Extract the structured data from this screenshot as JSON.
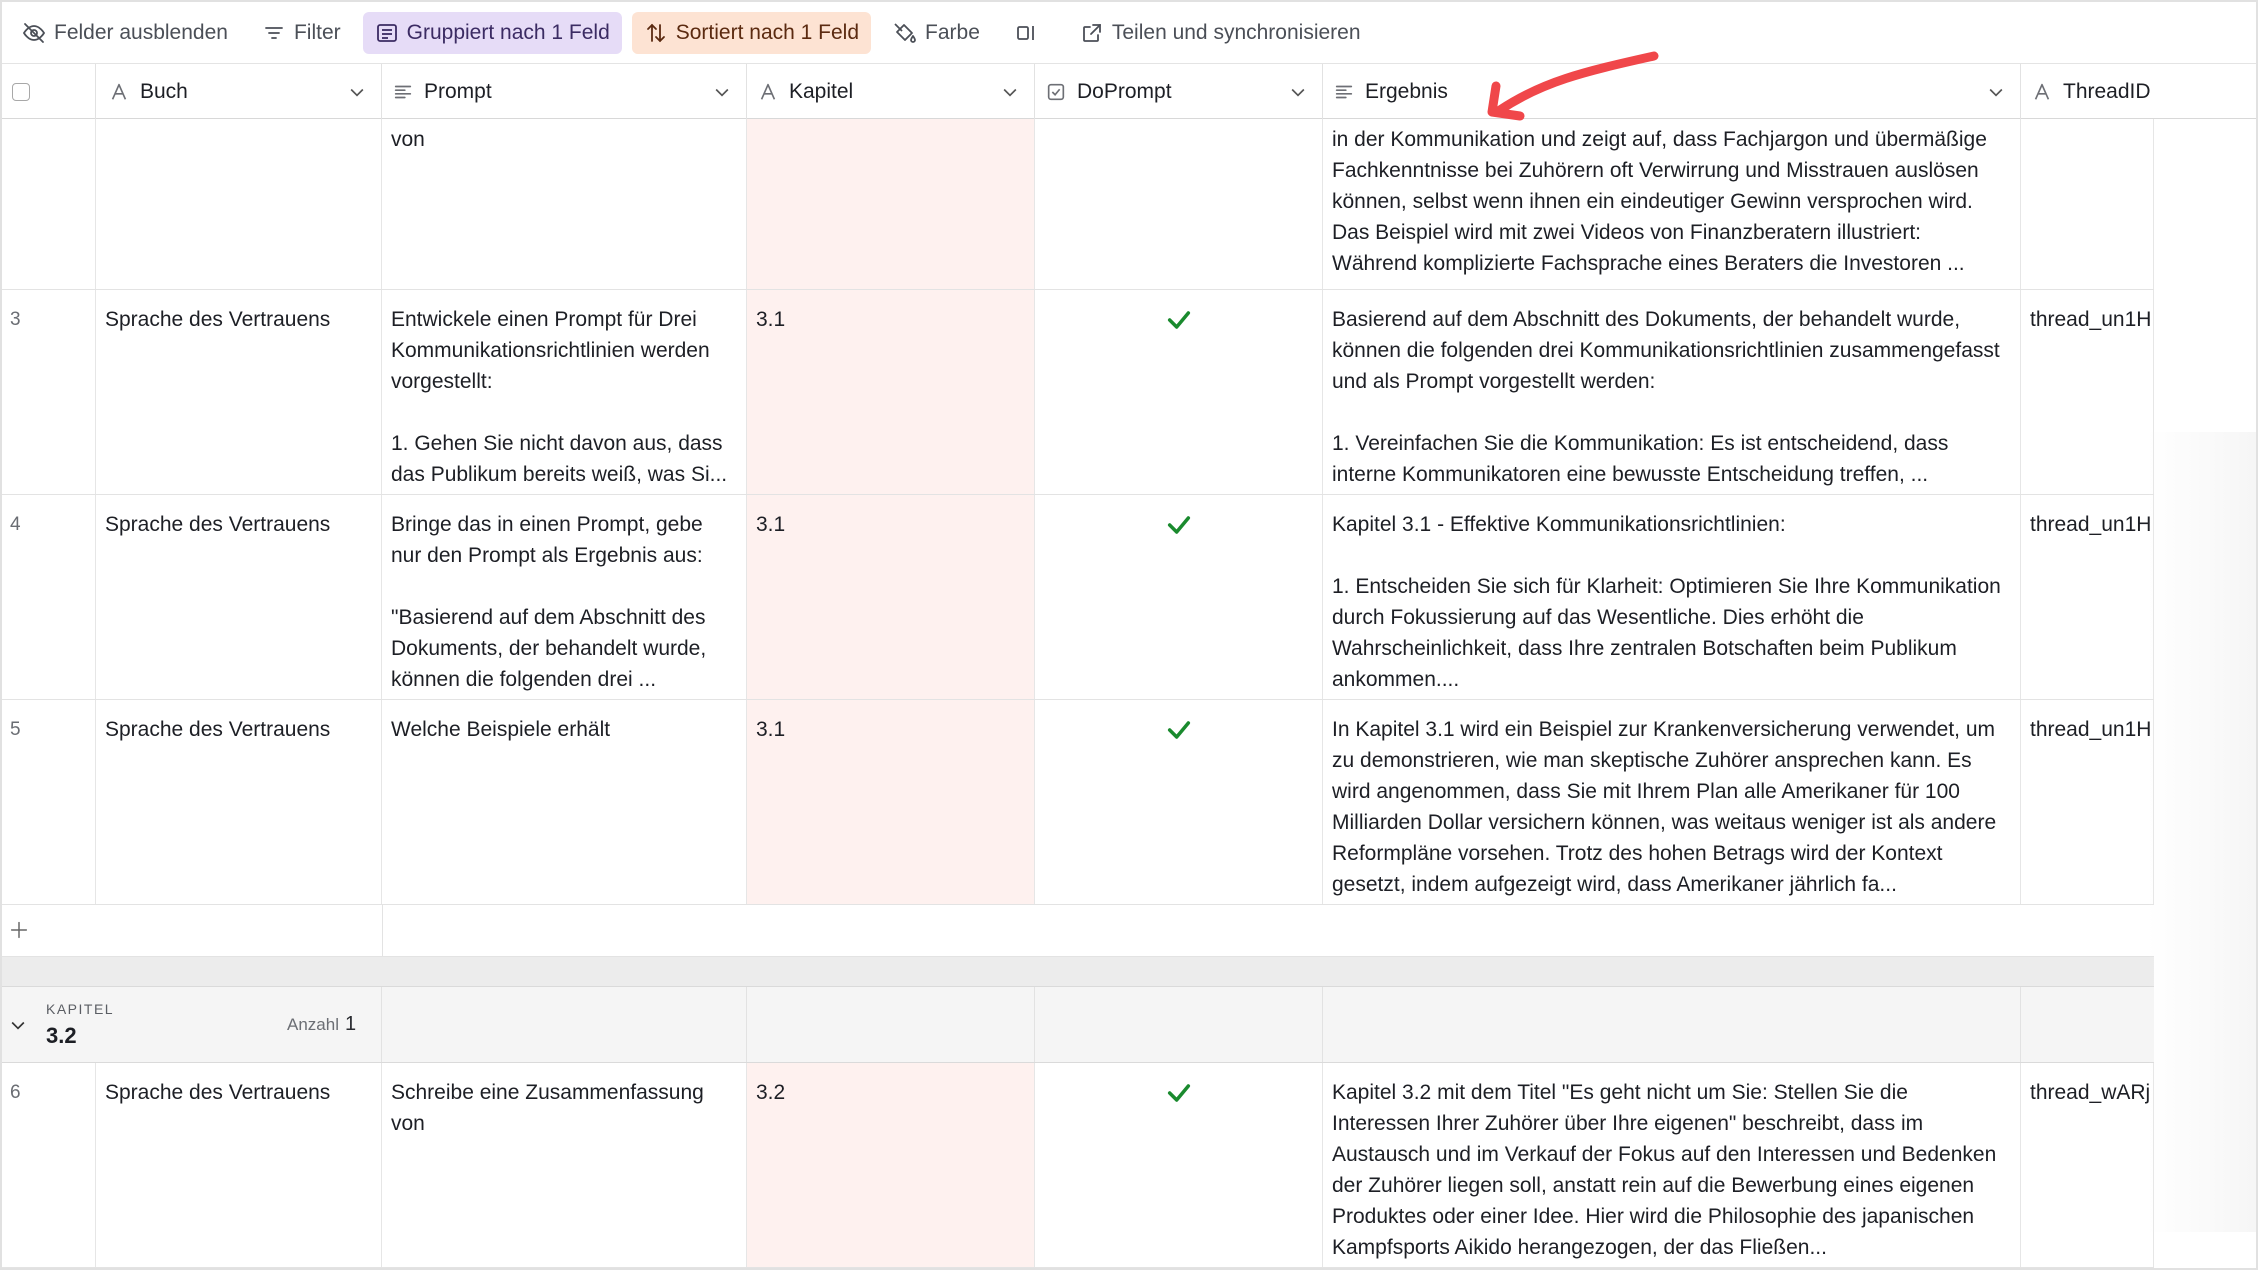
{
  "toolbar": {
    "hide_fields": "Felder ausblenden",
    "filter": "Filter",
    "grouped": "Gruppiert nach 1 Feld",
    "sorted": "Sortiert nach 1 Feld",
    "color": "Farbe",
    "share": "Teilen und synchronisieren"
  },
  "columns": {
    "buch": "Buch",
    "prompt": "Prompt",
    "kapitel": "Kapitel",
    "doprompt": "DoPrompt",
    "ergebnis": "Ergebnis",
    "threadid": "ThreadID"
  },
  "rows": [
    {
      "num": "",
      "buch": "",
      "prompt": "von",
      "kapitel": "",
      "doprompt": false,
      "ergebnis": "in der Kommunikation und zeigt auf, dass Fachjargon und übermäßige Fachkenntnisse bei Zuhörern oft Verwirrung und Misstrauen auslösen können, selbst wenn ihnen ein eindeutiger Gewinn versprochen wird. Das Beispiel wird mit zwei Videos von Finanzberatern illustriert: Während komplizierte Fachsprache eines Beraters die Investoren ...",
      "threadid": ""
    },
    {
      "num": "3",
      "buch": "Sprache des Vertrauens",
      "prompt": "Entwickele einen Prompt für Drei Kommunikationsrichtlinien werden vorgestellt:\n\n1. Gehen Sie nicht davon aus, dass das Publikum bereits weiß, was Si...",
      "kapitel": "3.1",
      "doprompt": true,
      "ergebnis": "Basierend auf dem Abschnitt des Dokuments, der behandelt wurde, können die folgenden drei Kommunikationsrichtlinien zusammengefasst und als Prompt vorgestellt werden:\n\n1. Vereinfachen Sie die Kommunikation: Es ist entscheidend, dass interne Kommunikatoren eine bewusste Entscheidung treffen, ...",
      "threadid": "thread_un1H"
    },
    {
      "num": "4",
      "buch": "Sprache des Vertrauens",
      "prompt": "Bringe das in einen Prompt, gebe nur den Prompt als Ergebnis aus:\n\n\"Basierend auf dem Abschnitt des Dokuments, der behandelt wurde, können die folgenden drei ...",
      "kapitel": "3.1",
      "doprompt": true,
      "ergebnis": "Kapitel 3.1 - Effektive Kommunikationsrichtlinien:\n\n1. Entscheiden Sie sich für Klarheit: Optimieren Sie Ihre Kommunikation durch Fokussierung auf das Wesentliche. Dies erhöht die Wahrscheinlichkeit, dass Ihre zentralen Botschaften beim Publikum ankommen....",
      "threadid": "thread_un1H"
    },
    {
      "num": "5",
      "buch": "Sprache des Vertrauens",
      "prompt": "Welche Beispiele erhält",
      "kapitel": "3.1",
      "doprompt": true,
      "ergebnis": "In Kapitel 3.1 wird ein Beispiel zur Krankenversicherung verwendet, um zu demonstrieren, wie man skeptische Zuhörer ansprechen kann. Es wird angenommen, dass Sie mit Ihrem Plan alle Amerikaner für 100 Milliarden Dollar versichern können, was weitaus weniger ist als andere Reformpläne vorsehen. Trotz des hohen Betrags wird der Kontext gesetzt, indem aufgezeigt wird, dass Amerikaner jährlich fa...",
      "threadid": "thread_un1H"
    },
    {
      "num": "6",
      "buch": "Sprache des Vertrauens",
      "prompt": "Schreibe eine Zusammenfassung von",
      "kapitel": "3.2",
      "doprompt": true,
      "ergebnis": "Kapitel 3.2 mit dem Titel \"Es geht nicht um Sie: Stellen Sie die Interessen Ihrer Zuhörer über Ihre eigenen\" beschreibt, dass im Austausch und im Verkauf der Fokus auf den Interessen und Bedenken der Zuhörer liegen soll, anstatt rein auf die Bewerbung eines eigenen Produktes oder einer Idee. Hier wird die Philosophie des japanischen Kampfsports Aikido herangezogen, der das Fließen...",
      "threadid": "thread_wARj"
    }
  ],
  "group": {
    "label": "KAPITEL",
    "value": "3.2",
    "count_label": "Anzahl",
    "count": "1"
  },
  "colors": {
    "grouped_bg": "#e6dcf7",
    "sorted_bg": "#fde3d3",
    "kapitel_bg": "#fef1ef",
    "check_green": "#1a8a2e",
    "arrow_red": "#f0474a"
  },
  "icons": {
    "hide_fields": "eye-slash-icon",
    "filter": "filter-lines-icon",
    "grouped": "group-list-icon",
    "sorted": "sort-arrows-icon",
    "color": "paint-bucket-icon",
    "row_height": "row-height-icon",
    "share": "share-external-icon",
    "check": "check-icon",
    "annotation": "red-arrow-annotation"
  }
}
